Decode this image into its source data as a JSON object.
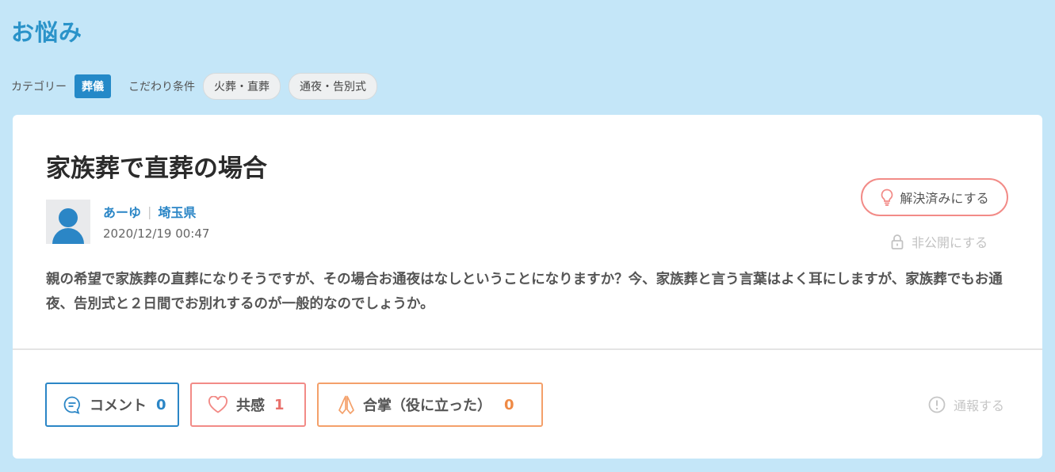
{
  "page": {
    "title": "お悩み"
  },
  "filters": {
    "category_label": "カテゴリー",
    "category": "葬儀",
    "conditions_label": "こだわり条件",
    "tags": [
      "火葬・直葬",
      "通夜・告別式"
    ]
  },
  "post": {
    "title": "家族葬で直葬の場合",
    "author": "あーゆ",
    "location": "埼玉県",
    "date": "2020/12/19 00:47",
    "body": "親の希望で家族葬の直葬になりそうですが、その場合お通夜はなしということになりますか？今、家族葬と言う言葉はよく耳にしますが、家族葬でもお通夜、告別式と２日間でお別れするのが一般的なのでしょうか。",
    "resolve_label": "解決済みにする",
    "private_label": "非公開にする"
  },
  "reactions": {
    "comment": {
      "label": "コメント",
      "count": "0",
      "icon": "comment-icon"
    },
    "empathy": {
      "label": "共感",
      "count": "1",
      "icon": "heart-icon"
    },
    "thanks": {
      "label": "合掌（役に立った）",
      "count": "0",
      "icon": "praying-hands-icon"
    }
  },
  "report_label": "通報する",
  "colors": {
    "background": "#c4e6f8",
    "accent": "#2b86c6",
    "empathy": "#f28b87",
    "thanks": "#f4a06a"
  }
}
